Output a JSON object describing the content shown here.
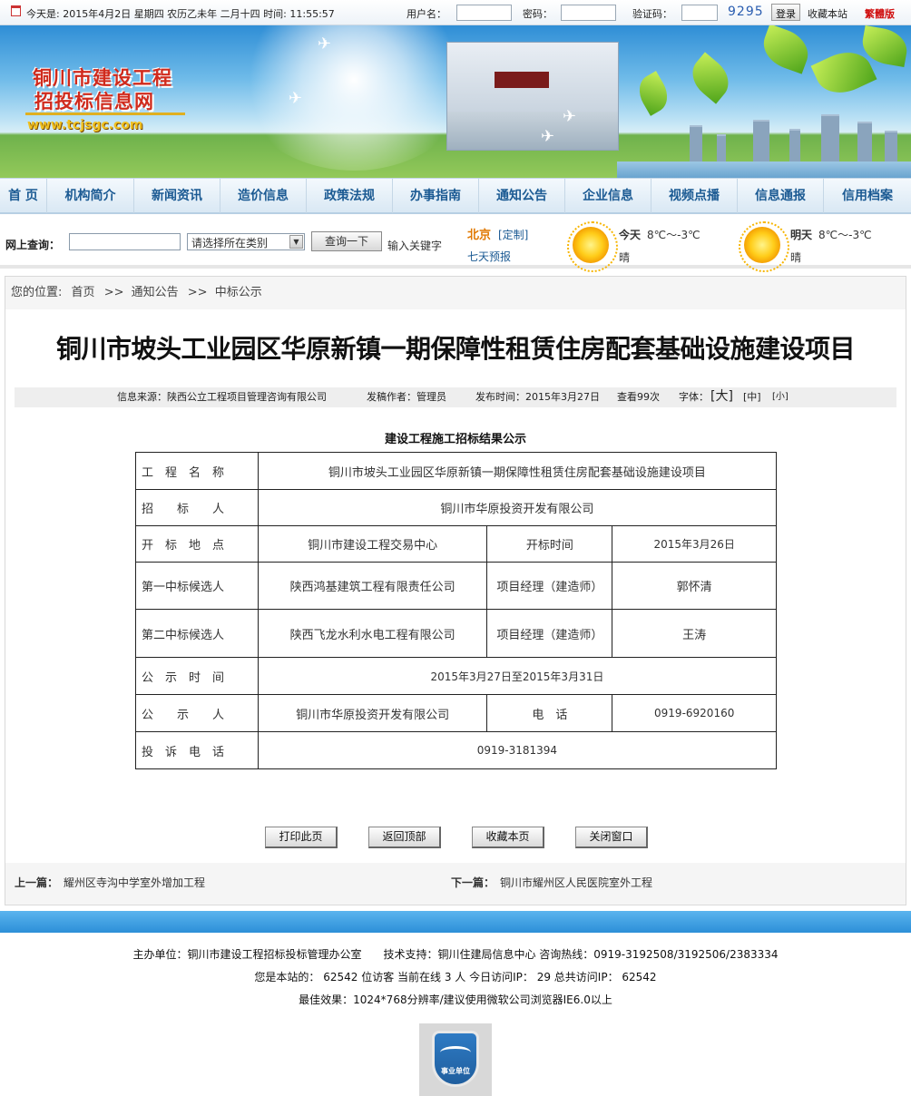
{
  "topbar": {
    "date_text": "今天是: 2015年4月2日 星期四 农历乙未年 二月十四  时间: 11:55:57",
    "username_label": "用户名：",
    "password_label": "密码：",
    "captcha_label": "验证码：",
    "captcha_code": "9295",
    "login_label": "登录",
    "bookmark_label": "收藏本站",
    "traditional_label": "繁體版"
  },
  "banner": {
    "logo_line1": "铜川市建设工程",
    "logo_line2": "招投标信息网",
    "logo_url": "www.tcjsgc.com"
  },
  "nav": {
    "items": [
      "首 页",
      "机构简介",
      "新闻资讯",
      "造价信息",
      "政策法规",
      "办事指南",
      "通知公告",
      "企业信息",
      "视频点播",
      "信息通报",
      "信用档案"
    ]
  },
  "search": {
    "label": "网上查询：",
    "category_placeholder": "请选择所在类别",
    "query_button": "查询一下",
    "hint": "输入关键字"
  },
  "weather": {
    "city": "北京",
    "customize": "[定制]",
    "forecast_link": "七天预报",
    "today_label": "今天",
    "today_temp": "8℃～-3℃",
    "today_desc": "晴",
    "tomorrow_label": "明天",
    "tomorrow_temp": "8℃～-3℃",
    "tomorrow_desc": "晴"
  },
  "breadcrumb": {
    "prefix": "您的位置:",
    "home": "首页",
    "sep": ">>",
    "level1": "通知公告",
    "level2": "中标公示"
  },
  "article": {
    "title": "铜川市坡头工业园区华原新镇一期保障性租赁住房配套基础设施建设项目",
    "source": "信息来源：陕西公立工程项目管理咨询有限公司",
    "author": "发稿作者：管理员",
    "date": "发布时间：2015年3月27日",
    "views": "查看99次",
    "font_label": "字体：",
    "font_large": "[大]",
    "font_medium": "[中]",
    "font_small": "[小]",
    "subtitle": "建设工程施工招标结果公示"
  },
  "table": {
    "project_name_label": "工　程　名　称",
    "project_name": "铜川市坡头工业园区华原新镇一期保障性租赁住房配套基础设施建设项目",
    "tenderer_label": "招　　标　　人",
    "tenderer": "铜川市华原投资开发有限公司",
    "opening_place_label": "开　标　地　点",
    "opening_place": "铜川市建设工程交易中心",
    "opening_time_label": "开标时间",
    "opening_time": "2015年3月26日",
    "first_candidate_label": "第一中标候选人",
    "first_candidate": "陕西鸿基建筑工程有限责任公司",
    "pm_label_1": "项目经理（建造师）",
    "pm_1": "郭怀清",
    "second_candidate_label": "第二中标候选人",
    "second_candidate": "陕西飞龙水利水电工程有限公司",
    "pm_label_2": "项目经理（建造师）",
    "pm_2": "王涛",
    "notice_period_label": "公　示　时　间",
    "notice_period": "2015年3月27日至2015年3月31日",
    "publisher_label": "公　　示　　人",
    "publisher": "铜川市华原投资开发有限公司",
    "phone_label": "电　话",
    "phone": "0919-6920160",
    "complaint_label": "投　诉　电　话",
    "complaint_phone": "0919-3181394"
  },
  "actions": {
    "print": "打印此页",
    "top": "返回顶部",
    "favorite": "收藏本页",
    "close": "关闭窗口"
  },
  "prevnext": {
    "prev_label": "上一篇：",
    "prev_title": "耀州区寺沟中学室外增加工程",
    "next_label": "下一篇：",
    "next_title": "铜川市耀州区人民医院室外工程"
  },
  "footer": {
    "line1": "主办单位：铜川市建设工程招标投标管理办公室　　技术支持：铜川住建局信息中心 咨询热线：0919-3192508/3192506/2383334",
    "line2": "您是本站的： 62542 位访客  当前在线 3 人  今日访问IP： 29  总共访问IP： 62542",
    "line3": "最佳效果：1024*768分辨率/建议使用微软公司浏览器IE6.0以上",
    "badge_text": "事业单位"
  }
}
